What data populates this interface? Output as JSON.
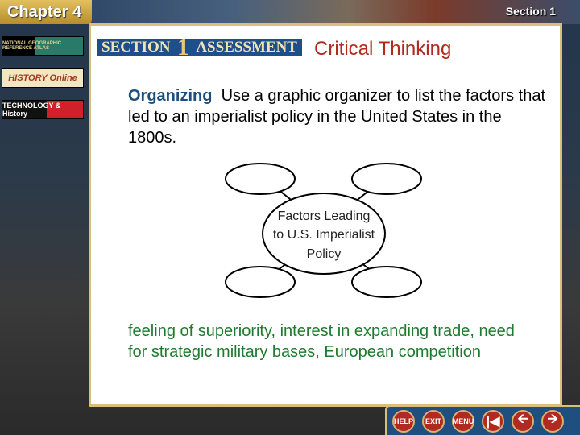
{
  "header": {
    "chapter": "Chapter 4",
    "section": "Section 1"
  },
  "sidebar": {
    "items": [
      {
        "label": "NATIONAL GEOGRAPHIC REFERENCE ATLAS"
      },
      {
        "label": "HISTORY Online"
      },
      {
        "label": "TECHNOLOGY & History"
      }
    ]
  },
  "slide": {
    "banner": {
      "left": "SECTION",
      "number": "1",
      "right": "ASSESSMENT"
    },
    "heading": "Critical Thinking",
    "question_keyword": "Organizing",
    "question": "Use a graphic organizer to list the factors that led to an imperialist policy in the United States in the 1800s.",
    "diagram_center": [
      "Factors Leading",
      "to U.S. Imperialist",
      "Policy"
    ],
    "answer": "feeling of superiority, interest in expanding trade, need for strategic military bases, European competition"
  },
  "nav": {
    "help": "HELP",
    "exit": "EXIT",
    "menu": "MENU",
    "first_icon": "first-slide-icon",
    "prev_icon": "arrow-left-icon",
    "next_icon": "arrow-right-icon"
  },
  "colors": {
    "heading": "#b02a1e",
    "keyword": "#1b4f80",
    "answer": "#1e7a2e",
    "nav_bg": "#1f4f7e",
    "button": "#b02a22",
    "chapter_tab": "#d4aa44"
  }
}
